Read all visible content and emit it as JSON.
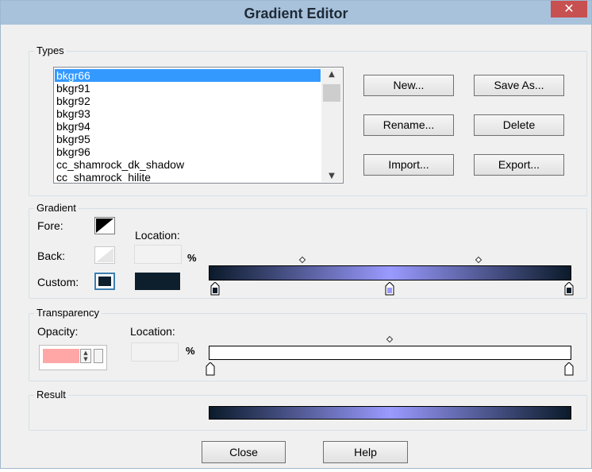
{
  "window": {
    "title": "Gradient Editor",
    "close_glyph": "✕"
  },
  "types": {
    "label": "Types",
    "items": [
      "bkgr66",
      "bkgr91",
      "bkgr92",
      "bkgr93",
      "bkgr94",
      "bkgr95",
      "bkgr96",
      "cc_shamrock_dk_shadow",
      "cc_shamrock_hilite"
    ],
    "selected_index": 0,
    "buttons": {
      "new": "New...",
      "save_as": "Save As...",
      "rename": "Rename...",
      "delete": "Delete",
      "import": "Import...",
      "export": "Export..."
    }
  },
  "gradient": {
    "label": "Gradient",
    "fore_label": "Fore:",
    "back_label": "Back:",
    "custom_label": "Custom:",
    "location_label": "Location:",
    "percent": "%",
    "location_value": "",
    "colors": {
      "dark": "#0b1a2a",
      "light": "#9a9aff",
      "custom": "#0d1f2d"
    },
    "stops_percent": [
      0,
      50,
      100
    ],
    "midpoints_percent": [
      25,
      75
    ]
  },
  "transparency": {
    "label": "Transparency",
    "opacity_label": "Opacity:",
    "location_label": "Location:",
    "percent": "%",
    "opacity_color": "#ffa6a6",
    "location_value": "",
    "stops_percent": [
      0,
      100
    ],
    "midpoints_percent": [
      50
    ]
  },
  "result": {
    "label": "Result"
  },
  "footer": {
    "close": "Close",
    "help": "Help"
  }
}
